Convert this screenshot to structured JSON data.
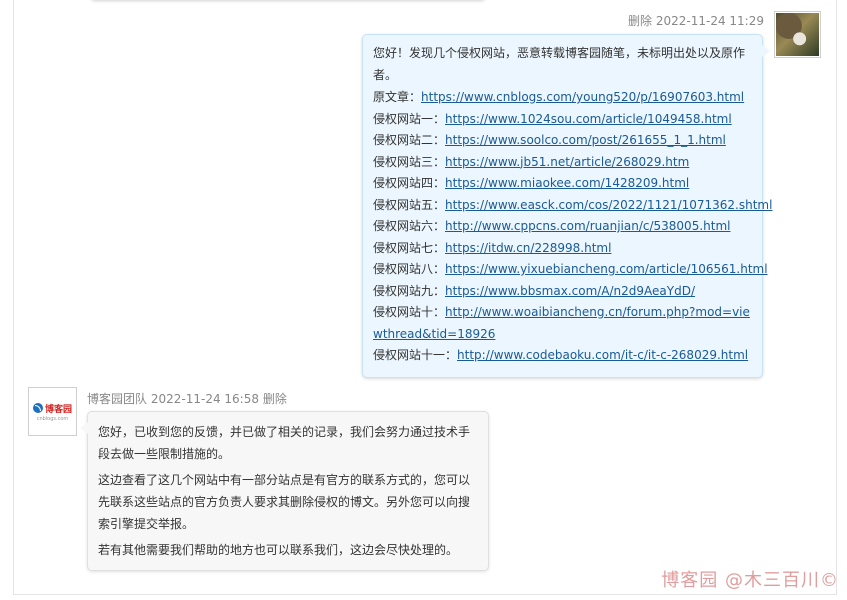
{
  "first_message": {
    "delete_label": "删除",
    "timestamp": "2022-11-24 11:29",
    "intro": "您好！发现几个侵权网站，恶意转载博客园随笔，未标明出处以及原作者。",
    "lines": [
      {
        "label": "原文章：",
        "url": "https://www.cnblogs.com/young520/p/16907603.html"
      },
      {
        "label": "侵权网站一：",
        "url": "https://www.1024sou.com/article/1049458.html"
      },
      {
        "label": "侵权网站二：",
        "url": "https://www.soolco.com/post/261655_1_1.html"
      },
      {
        "label": "侵权网站三：",
        "url": "https://www.jb51.net/article/268029.htm"
      },
      {
        "label": "侵权网站四：",
        "url": "https://www.miaokee.com/1428209.html"
      },
      {
        "label": "侵权网站五：",
        "url": "https://www.easck.com/cos/2022/1121/1071362.shtml"
      },
      {
        "label": "侵权网站六：",
        "url": "http://www.cppcns.com/ruanjian/c/538005.html"
      },
      {
        "label": "侵权网站七：",
        "url": "https://itdw.cn/228998.html"
      },
      {
        "label": "侵权网站八：",
        "url": "https://www.yixuebiancheng.com/article/106561.html"
      },
      {
        "label": "侵权网站九：",
        "url": "https://www.bbsmax.com/A/n2d9AeaYdD/"
      },
      {
        "label": "侵权网站十：",
        "url": "http://www.woaibiancheng.cn/forum.php?mod=viewthread&tid=18926"
      },
      {
        "label": "侵权网站十一：",
        "url": "http://www.codebaoku.com/it-c/it-c-268029.html"
      }
    ]
  },
  "reply": {
    "author": "博客园团队",
    "timestamp": "2022-11-24 16:58",
    "delete_label": "删除",
    "logo_text": "博客园",
    "logo_sub": "cnblogs.com",
    "paragraphs": [
      "您好，已收到您的反馈，并已做了相关的记录，我们会努力通过技术手段去做一些限制措施的。",
      "这边查看了这几个网站中有一部分站点是有官方的联系方式的，您可以先联系这些站点的官方负责人要求其删除侵权的博文。另外您可以向搜索引擎提交举报。",
      "若有其他需要我们帮助的地方也可以联系我们，这边会尽快处理的。"
    ]
  },
  "watermark": "博客园 @木三百川©"
}
